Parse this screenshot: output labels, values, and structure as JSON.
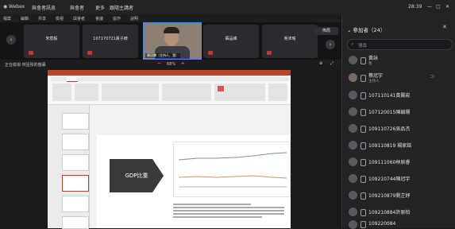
{
  "title_bar": {
    "app": "Webex",
    "tabs": [
      "與會者訊息",
      "與會者",
      "更多",
      "跟隨主講者"
    ],
    "time": "28:39"
  },
  "menu_bar": {
    "items": [
      "檔案",
      "編輯",
      "共享",
      "檢視",
      "與會者",
      "會議",
      "協作",
      "說明"
    ]
  },
  "video_strip": {
    "tiles": [
      "朱宸毅",
      "107170721黃子綺",
      "",
      "蘇品維",
      "吳沛瑤"
    ],
    "self_label": "陳冠霖（主持人、我）",
    "layout_button": "佈局"
  },
  "share_bar": {
    "label": "正在檢視 林昱彤的螢幕",
    "zoom": "68%"
  },
  "slide": {
    "box_text": "GDP比重"
  },
  "participants": {
    "header": "參加者（24）",
    "search_placeholder": "搜尋",
    "rows": [
      {
        "name": "黃詠",
        "sub": "我"
      },
      {
        "name": "蔡冠宇",
        "sub": "主持人"
      },
      {
        "name": "107110141黃翼崧"
      },
      {
        "name": "107120015陳穎珊"
      },
      {
        "name": "109110726吳品杰"
      },
      {
        "name": "109110819 楊家銘"
      },
      {
        "name": "109111060林辰睿"
      },
      {
        "name": "109210744陳冠宇"
      },
      {
        "name": "109210879劉芷妤"
      },
      {
        "name": "109210884許原柏"
      },
      {
        "name": "109220084"
      }
    ]
  },
  "colors": {
    "accent": "#4a8bd8",
    "mic_muted": "#c0392b",
    "slide_box": "#3a3a3a"
  }
}
